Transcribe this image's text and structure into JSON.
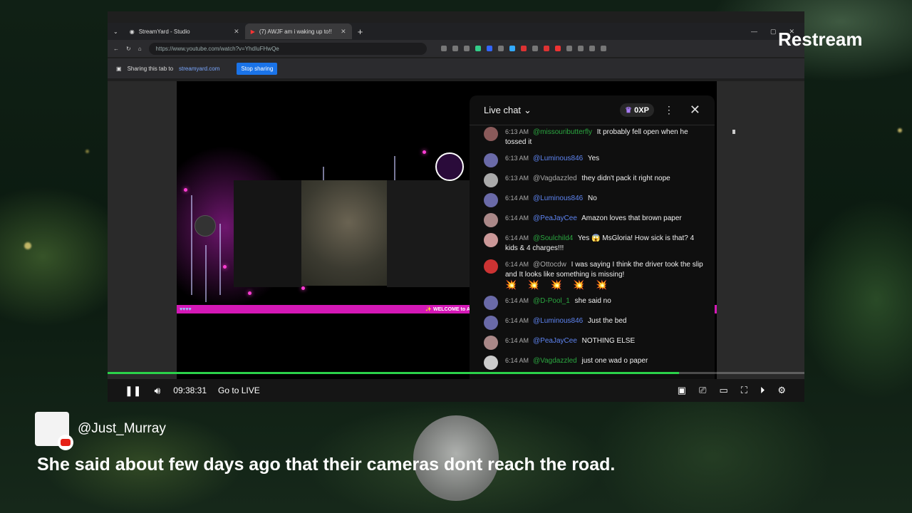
{
  "browser": {
    "tab1": "StreamYard - Studio",
    "tab2": "(7) AWJF am i waking up to!!",
    "url": "https://www.youtube.com/watch?v=YhdIuFHwQe",
    "sharing_text": "Sharing this tab to",
    "sharing_target": "streamyard.com",
    "stop_sharing": "Stop sharing"
  },
  "video": {
    "ticker_text": "✨ WELCOME to AWBJ! PLEA"
  },
  "chat": {
    "title": "Live chat",
    "xp": "0XP",
    "messages": [
      {
        "time": "6:13 AM",
        "user": "@missouributterfly",
        "color": "green",
        "text": "It probably fell open when he tossed it"
      },
      {
        "time": "6:13 AM",
        "user": "@Luminous846",
        "color": "blue",
        "text": "Yes"
      },
      {
        "time": "6:13 AM",
        "user": "@Vagdazzled",
        "color": "gray",
        "text": "they didn't pack it right nope"
      },
      {
        "time": "6:14 AM",
        "user": "@Luminous846",
        "color": "blue",
        "text": "No"
      },
      {
        "time": "6:14 AM",
        "user": "@PeaJayCee",
        "color": "blue",
        "text": "Amazon loves that brown paper"
      },
      {
        "time": "6:14 AM",
        "user": "@Soulchild4",
        "color": "green",
        "text": "Yes 😱 MsGloria! How sick is that? 4 kids & 4 charges!!!"
      },
      {
        "time": "6:14 AM",
        "user": "@Ottocdw",
        "color": "gray",
        "text": "I was saying I think the driver took the slip and It looks like something is missing!"
      },
      {
        "time": "6:14 AM",
        "user": "@D-Pool_1",
        "color": "green",
        "text": "she said no"
      },
      {
        "time": "6:14 AM",
        "user": "@Luminous846",
        "color": "blue",
        "text": "Just the bed"
      },
      {
        "time": "6:14 AM",
        "user": "@PeaJayCee",
        "color": "blue",
        "text": "NOTHING ELSE"
      },
      {
        "time": "6:14 AM",
        "user": "@Vagdazzled",
        "color": "green",
        "text": "just one wad o paper"
      }
    ],
    "emoji_row": "💥 💥 💥 💥 💥"
  },
  "player": {
    "time": "09:38:31",
    "go_live": "Go to LIVE",
    "progress": 0.82
  },
  "overlay": {
    "brand": "Restream",
    "commenter": "@Just_Murray",
    "comment": "She said about few days ago that their cameras dont reach the road."
  }
}
